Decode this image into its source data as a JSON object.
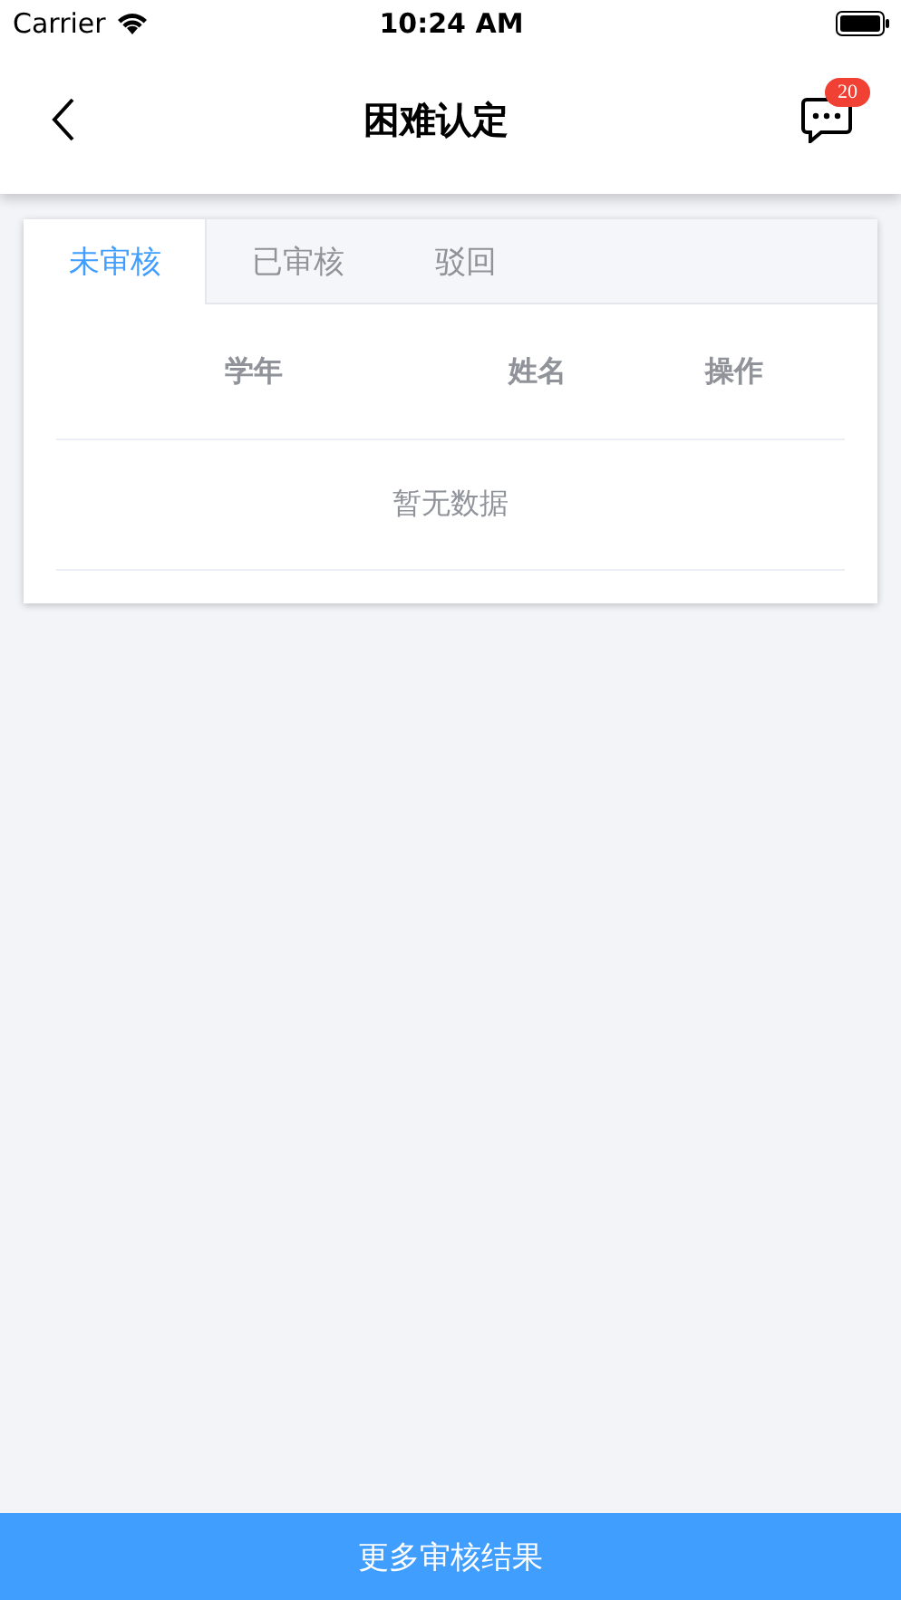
{
  "status_bar": {
    "carrier": "Carrier",
    "time": "10:24 AM"
  },
  "header": {
    "title": "困难认定",
    "badge": "20"
  },
  "tabs": [
    {
      "label": "未审核",
      "selected": true
    },
    {
      "label": "已审核",
      "selected": false
    },
    {
      "label": "驳回",
      "selected": false
    }
  ],
  "table": {
    "columns": [
      "学年",
      "姓名",
      "操作"
    ],
    "empty_text": "暂无数据"
  },
  "bottom_button": "更多审核结果"
}
